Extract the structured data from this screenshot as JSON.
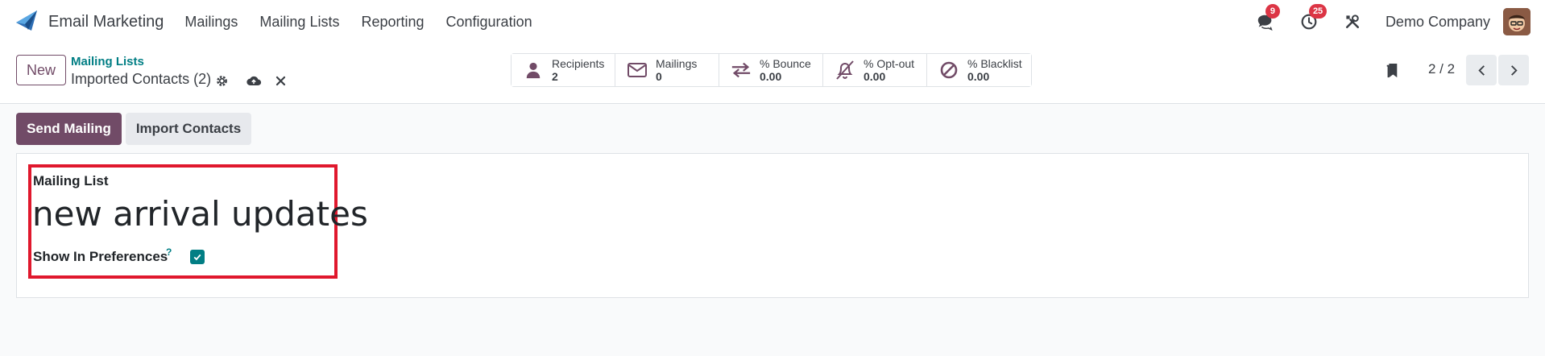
{
  "app": {
    "name": "Email Marketing"
  },
  "menu": [
    {
      "label": "Mailings"
    },
    {
      "label": "Mailing Lists"
    },
    {
      "label": "Reporting"
    },
    {
      "label": "Configuration"
    }
  ],
  "systray": {
    "messages_count": "9",
    "activities_count": "25",
    "company": "Demo Company"
  },
  "control": {
    "new_label": "New",
    "breadcrumb": "Mailing Lists",
    "record_name": "Imported Contacts (2)",
    "pager": "2 / 2"
  },
  "stats": [
    {
      "label": "Recipients",
      "value": "2",
      "icon": "user-icon"
    },
    {
      "label": "Mailings",
      "value": "0",
      "icon": "envelope-icon"
    },
    {
      "label": "% Bounce",
      "value": "0.00",
      "icon": "exchange-icon"
    },
    {
      "label": "% Opt-out",
      "value": "0.00",
      "icon": "bell-slash-icon"
    },
    {
      "label": "% Blacklist",
      "value": "0.00",
      "icon": "ban-icon"
    }
  ],
  "actions": {
    "send_label": "Send Mailing",
    "import_label": "Import Contacts"
  },
  "form": {
    "title_label": "Mailing List",
    "title_value": "new arrival updates",
    "pref_label": "Show In Preferences",
    "pref_help": "?",
    "pref_checked": true
  },
  "colors": {
    "primary": "#714b67",
    "accent": "#017e84",
    "highlight": "#e0182d",
    "badge": "#dc3545"
  }
}
